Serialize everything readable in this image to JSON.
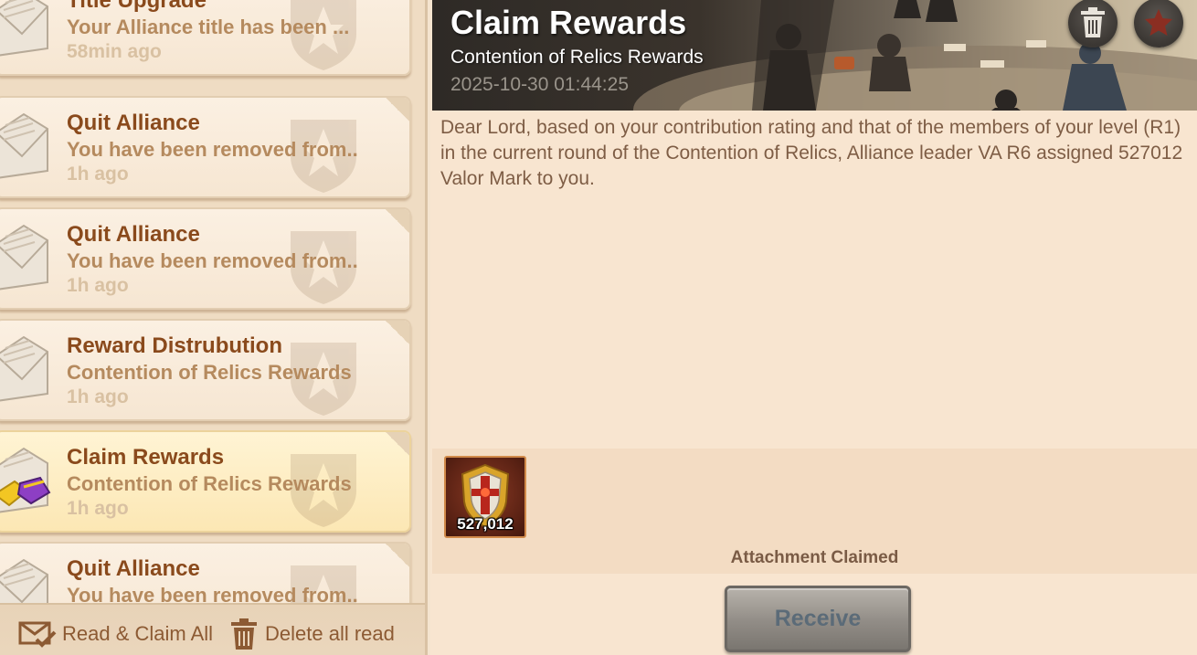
{
  "mail_list": [
    {
      "title": "Title Upgrade",
      "preview": "Your Alliance title has been ...",
      "time": "58min ago",
      "selected": false
    },
    {
      "title": "Quit Alliance",
      "preview": "You have been removed from..",
      "time": "1h ago",
      "selected": false
    },
    {
      "title": "Quit Alliance",
      "preview": "You have been removed from..",
      "time": "1h ago",
      "selected": false
    },
    {
      "title": "Reward Distrubution",
      "preview": "Contention of Relics Rewards",
      "time": "1h ago",
      "selected": false
    },
    {
      "title": "Claim Rewards",
      "preview": "Contention of Relics Rewards",
      "time": "1h ago",
      "selected": true
    },
    {
      "title": "Quit Alliance",
      "preview": "You have been removed from..",
      "time": "",
      "selected": false
    }
  ],
  "footer": {
    "read_claim_all": "Read & Claim All",
    "delete_all_read": "Delete all read"
  },
  "detail": {
    "title": "Claim Rewards",
    "subtitle": "Contention of Relics Rewards",
    "date": "2025-10-30 01:44:25",
    "body": "Dear Lord, based on your contribution rating and that of the members of your level (R1) in the current round of the Contention of Relics, Alliance leader VA R6 assigned 527012 Valor Mark to you.",
    "attachment": {
      "icon": "valor-mark-icon",
      "count": "527,012"
    },
    "attachment_status": "Attachment Claimed",
    "receive_label": "Receive"
  },
  "colors": {
    "title_brown": "#8a4a1c",
    "preview_tan": "#b58a5e",
    "time_faded": "#d9c1a2",
    "panel_bg": "#f8e5d0",
    "receive_disabled": "#918c86"
  }
}
